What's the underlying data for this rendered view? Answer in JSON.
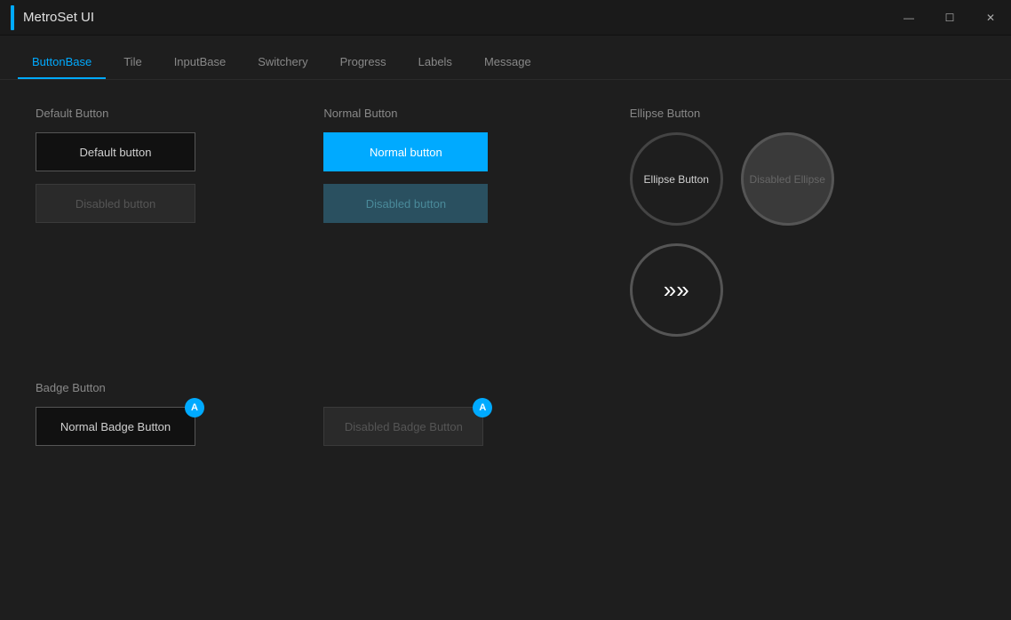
{
  "app": {
    "title": "MetroSet UI",
    "accent_color": "#00aaff"
  },
  "titlebar": {
    "minimize_label": "—",
    "maximize_label": "☐",
    "close_label": "✕"
  },
  "tabs": [
    {
      "id": "buttonbase",
      "label": "ButtonBase",
      "active": true
    },
    {
      "id": "tile",
      "label": "Tile",
      "active": false
    },
    {
      "id": "inputbase",
      "label": "InputBase",
      "active": false
    },
    {
      "id": "switchery",
      "label": "Switchery",
      "active": false
    },
    {
      "id": "progress",
      "label": "Progress",
      "active": false
    },
    {
      "id": "labels",
      "label": "Labels",
      "active": false
    },
    {
      "id": "message",
      "label": "Message",
      "active": false
    }
  ],
  "sections": {
    "default_button": {
      "label": "Default Button",
      "normal_text": "Default button",
      "disabled_text": "Disabled button"
    },
    "normal_button": {
      "label": "Normal Button",
      "normal_text": "Normal button",
      "disabled_text": "Disabled button"
    },
    "ellipse_button": {
      "label": "Ellipse Button",
      "normal_text": "Ellipse Button",
      "disabled_text": "Disabled Ellipse",
      "arrow_text": "»"
    },
    "badge_button": {
      "label": "Badge Button",
      "normal_text": "Normal Badge Button",
      "disabled_text": "Disabled Badge Button",
      "badge_char": "A"
    }
  }
}
